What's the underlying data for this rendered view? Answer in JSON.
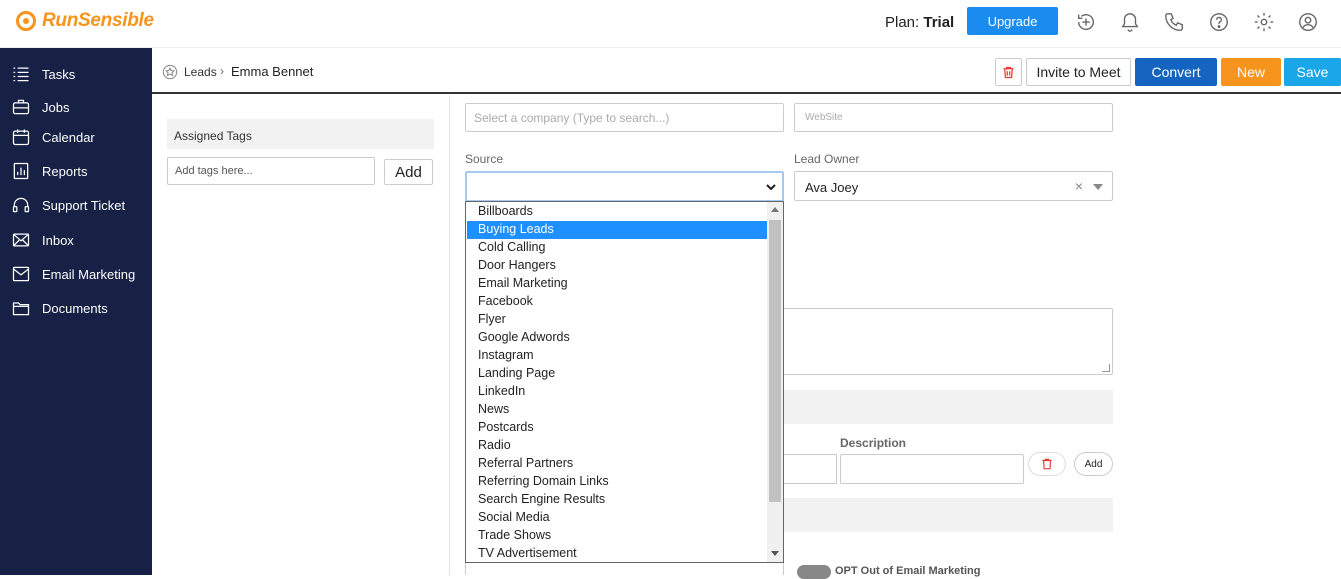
{
  "app": {
    "brand": "RunSensible"
  },
  "topbar": {
    "plan_label": "Plan:",
    "plan_value": "Trial",
    "upgrade_label": "Upgrade",
    "icons": [
      "add-icon",
      "bell-icon",
      "phone-icon",
      "help-icon",
      "gear-icon",
      "user-icon"
    ]
  },
  "sidebar": {
    "items": [
      {
        "label": "Tasks",
        "icon": "tasks-icon"
      },
      {
        "label": "Jobs",
        "icon": "jobs-icon"
      },
      {
        "label": "Calendar",
        "icon": "calendar-icon"
      },
      {
        "label": "Reports",
        "icon": "reports-icon"
      },
      {
        "label": "Support Ticket",
        "icon": "headset-icon"
      },
      {
        "label": "Inbox",
        "icon": "inbox-icon"
      },
      {
        "label": "Email Marketing",
        "icon": "email-marketing-icon"
      },
      {
        "label": "Documents",
        "icon": "folder-icon"
      }
    ]
  },
  "header": {
    "crumb_parent": "Leads",
    "crumb_current": "Emma Bennet",
    "invite_label": "Invite to Meet",
    "convert_label": "Convert",
    "new_label": "New",
    "save_label": "Save"
  },
  "tags": {
    "heading": "Assigned Tags",
    "input_placeholder": "Add tags here...",
    "add_label": "Add"
  },
  "form": {
    "company_placeholder": "Select a company (Type to search...)",
    "website_placeholder": "WebSite",
    "source_label": "Source",
    "source_value": "",
    "lead_owner_label": "Lead Owner",
    "lead_owner_value": "Ava Joey",
    "description_label": "Description",
    "description_add_label": "Add",
    "opt_out_label": "OPT Out of Email Marketing"
  },
  "source_options": {
    "selected": "Buying Leads",
    "items": [
      "Billboards",
      "Buying Leads",
      "Cold Calling",
      "Door Hangers",
      "Email Marketing",
      "Facebook",
      "Flyer",
      "Google Adwords",
      "Instagram",
      "Landing Page",
      "LinkedIn",
      "News",
      "Postcards",
      "Radio",
      "Referral Partners",
      "Referring Domain Links",
      "Search Engine Results",
      "Social Media",
      "Trade Shows",
      "TV Advertisement"
    ]
  },
  "colors": {
    "sidebar_bg": "#172045",
    "brand_orange": "#f7941d",
    "primary_blue": "#1565c0",
    "upgrade_blue": "#1a8cf0",
    "save_blue": "#1aa6e8",
    "selection_blue": "#1e90ff"
  }
}
